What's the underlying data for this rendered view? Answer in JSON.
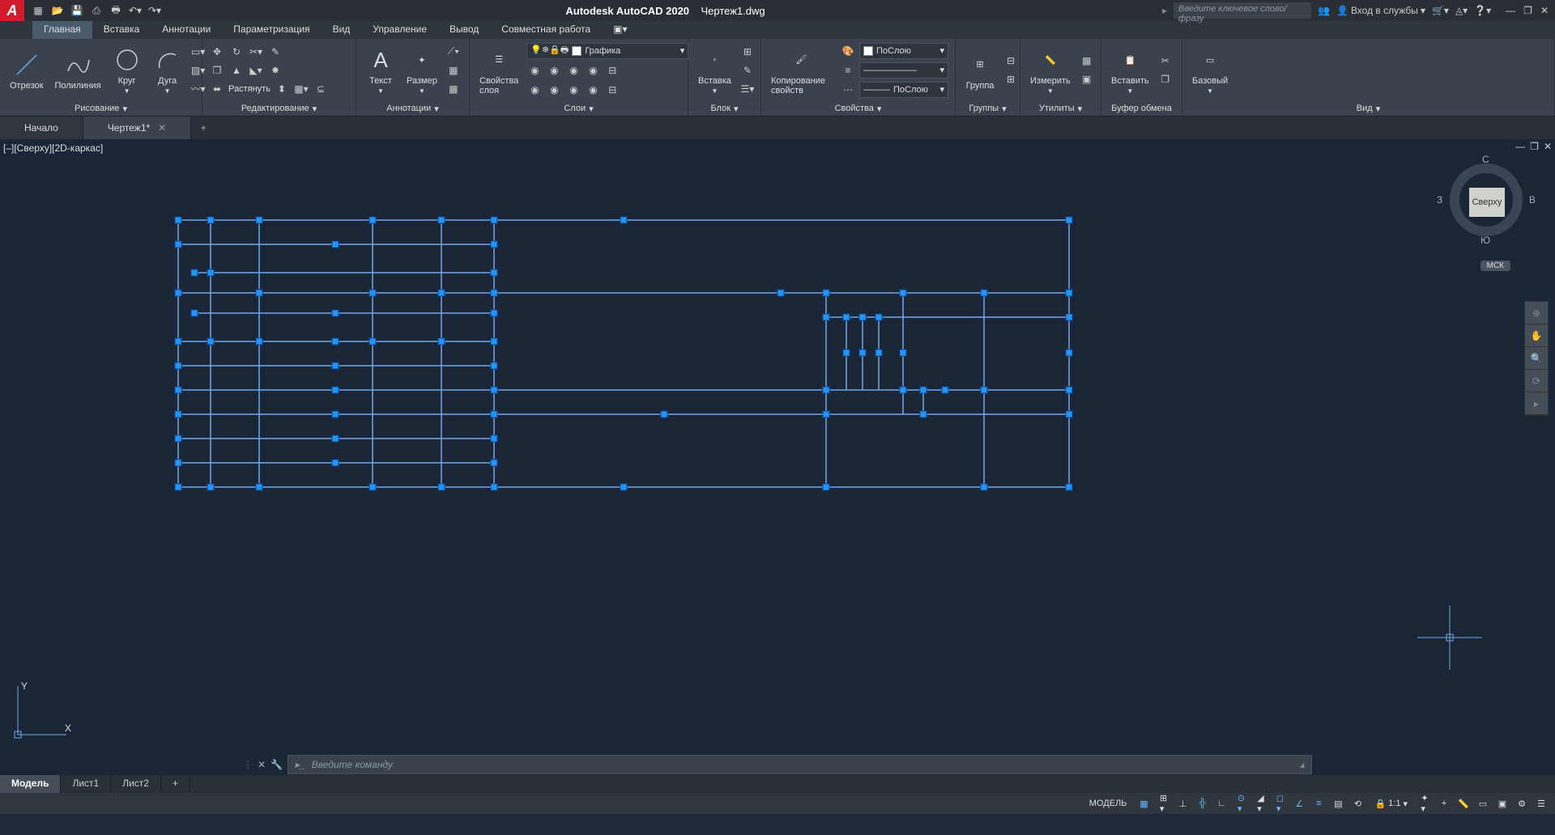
{
  "title": {
    "app": "Autodesk AutoCAD 2020",
    "file": "Чертеж1.dwg"
  },
  "search_placeholder": "Введите ключевое слово/фразу",
  "account_label": "Вход в службы",
  "menu_tabs": [
    "Главная",
    "Вставка",
    "Аннотации",
    "Параметризация",
    "Вид",
    "Управление",
    "Вывод",
    "Совместная работа"
  ],
  "ribbon": {
    "draw": {
      "line": "Отрезок",
      "polyline": "Полилиния",
      "circle": "Круг",
      "arc": "Дуга",
      "title": "Рисование"
    },
    "modify": {
      "stretch": "Растянуть",
      "title": "Редактирование"
    },
    "annot": {
      "text": "Текст",
      "dim": "Размер",
      "title": "Аннотации"
    },
    "layers": {
      "props": "Свойства слоя",
      "current": "Графика",
      "title": "Слои"
    },
    "block": {
      "insert": "Вставка",
      "title": "Блок"
    },
    "props": {
      "match": "Копирование свойств",
      "bylayer1": "ПоСлою",
      "bylayer2": "ПоСлою",
      "title": "Свойства"
    },
    "groups": {
      "group": "Группа",
      "title": "Группы"
    },
    "utils": {
      "measure": "Измерить",
      "title": "Утилиты"
    },
    "clip": {
      "paste": "Вставить",
      "title": "Буфер обмена"
    },
    "view": {
      "base": "Базовый",
      "title": "Вид"
    }
  },
  "doc_tabs": {
    "start": "Начало",
    "drawing": "Чертеж1*"
  },
  "viewport": {
    "label": "[–][Сверху][2D-каркас]",
    "cube_face": "Сверху",
    "n": "С",
    "s": "Ю",
    "w": "З",
    "e": "В",
    "wcs": "МСК"
  },
  "ucs": {
    "x": "X",
    "y": "Y"
  },
  "cmd": {
    "placeholder": "Введите команду"
  },
  "layout_tabs": [
    "Модель",
    "Лист1",
    "Лист2"
  ],
  "status": {
    "model": "МОДЕЛЬ",
    "scale": "1:1"
  }
}
